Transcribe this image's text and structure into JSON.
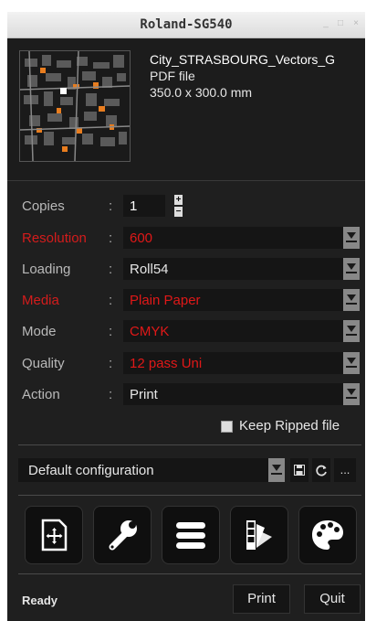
{
  "window": {
    "title": "Roland-SG540",
    "minimize": "_",
    "maximize": "□",
    "close": "×"
  },
  "file": {
    "name": "City_STRASBOURG_Vectors_G",
    "type": "PDF file",
    "size": "350.0 x 300.0 mm",
    "thumbnail_icon": "city-map-thumbnail"
  },
  "settings": {
    "colon": ":",
    "copies": {
      "label": "Copies",
      "value": "1"
    },
    "resolution": {
      "label": "Resolution",
      "value": "600"
    },
    "loading": {
      "label": "Loading",
      "value": "Roll54"
    },
    "media": {
      "label": "Media",
      "value": "Plain Paper"
    },
    "mode": {
      "label": "Mode",
      "value": "CMYK"
    },
    "quality": {
      "label": "Quality",
      "value": "12 pass Uni"
    },
    "action": {
      "label": "Action",
      "value": "Print"
    },
    "keep_ripped": {
      "label": "Keep Ripped file",
      "checked": false
    }
  },
  "configuration": {
    "value": "Default configuration",
    "save_icon": "save-icon",
    "refresh_icon": "refresh-icon",
    "more_label": "..."
  },
  "tools": [
    "add-file-icon",
    "wrench-icon",
    "menu-icon",
    "swatches-icon",
    "palette-icon"
  ],
  "footer": {
    "status": "Ready",
    "print_label": "Print",
    "quit_label": "Quit"
  },
  "colors": {
    "background": "#1f1f1f",
    "label_red": "#d41c1c",
    "value_red": "#e01818",
    "label_gray": "#b9b9b9",
    "accent_orange": "#e87d1f"
  }
}
